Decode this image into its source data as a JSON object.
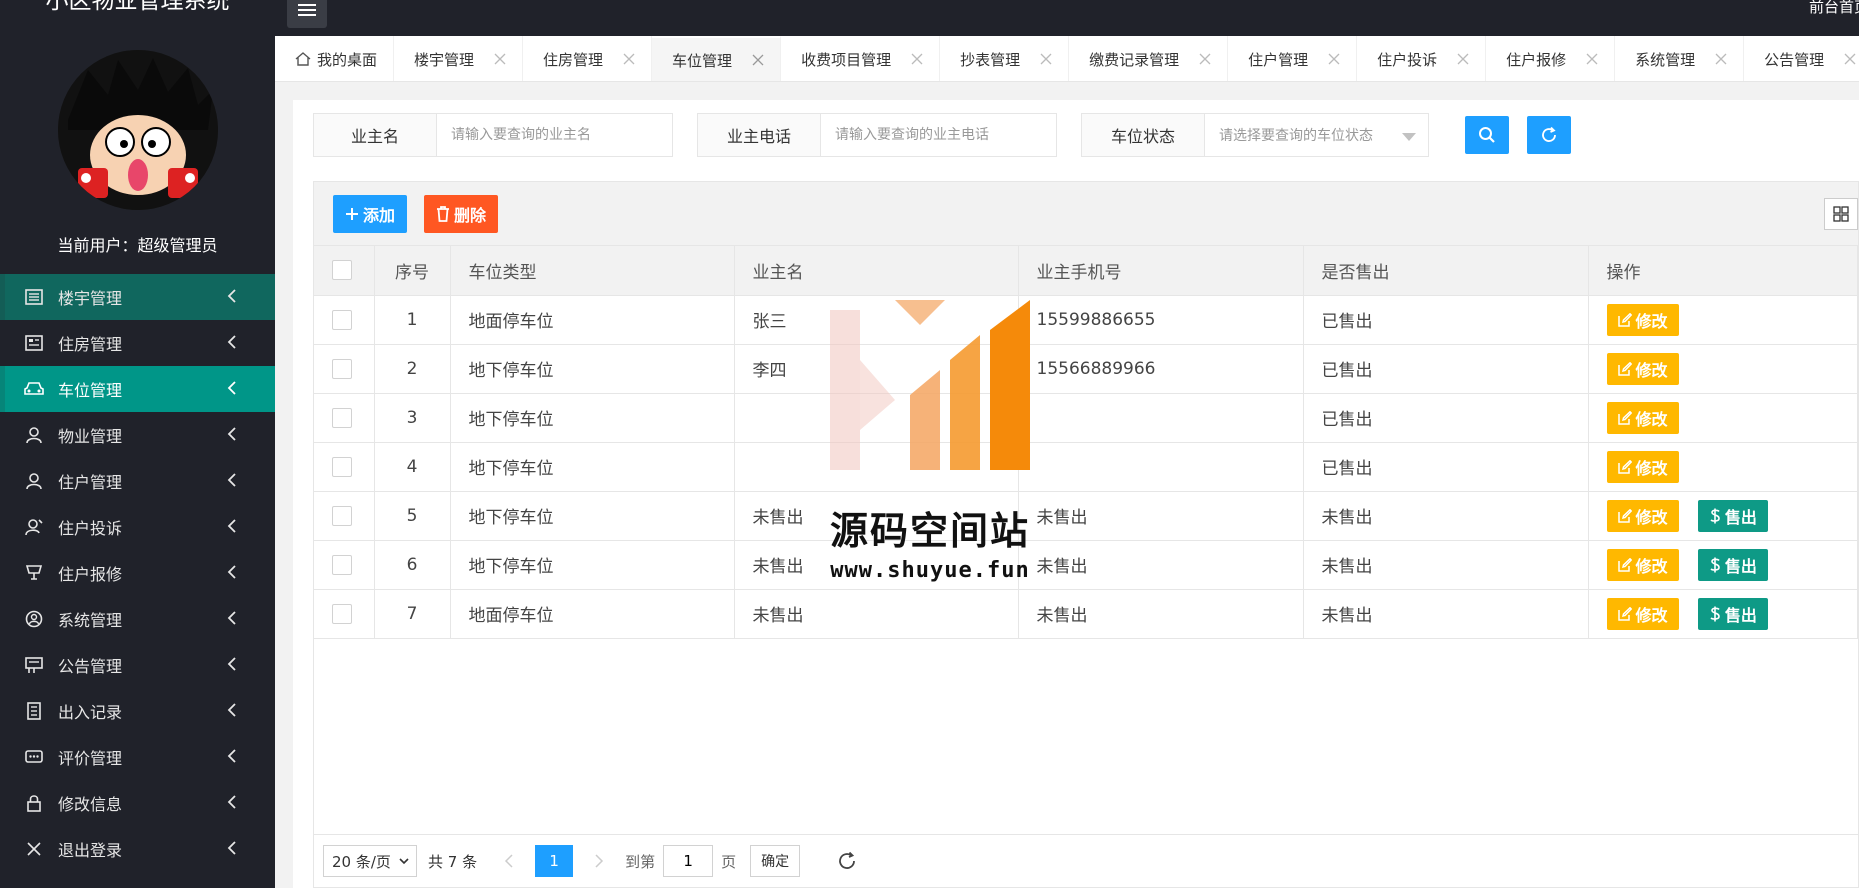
{
  "app": {
    "title": "小区物业管理系统",
    "current_user": "当前用户：超级管理员",
    "top_right": "前台首页"
  },
  "sidebar": {
    "items": [
      {
        "label": "楼宇管理",
        "icon": "building-icon"
      },
      {
        "label": "住房管理",
        "icon": "house-icon"
      },
      {
        "label": "车位管理",
        "icon": "car-icon"
      },
      {
        "label": "物业管理",
        "icon": "person-icon"
      },
      {
        "label": "住户管理",
        "icon": "user-icon"
      },
      {
        "label": "住户投诉",
        "icon": "complaint-icon"
      },
      {
        "label": "住户报修",
        "icon": "repair-icon"
      },
      {
        "label": "系统管理",
        "icon": "system-icon"
      },
      {
        "label": "公告管理",
        "icon": "notice-icon"
      },
      {
        "label": "出入记录",
        "icon": "record-icon"
      },
      {
        "label": "评价管理",
        "icon": "comment-icon"
      },
      {
        "label": "修改信息",
        "icon": "lock-icon"
      },
      {
        "label": "退出登录",
        "icon": "logout-icon"
      }
    ]
  },
  "tabs": [
    {
      "label": "我的桌面"
    },
    {
      "label": "楼宇管理"
    },
    {
      "label": "住房管理"
    },
    {
      "label": "车位管理"
    },
    {
      "label": "收费项目管理"
    },
    {
      "label": "抄表管理"
    },
    {
      "label": "缴费记录管理"
    },
    {
      "label": "住户管理"
    },
    {
      "label": "住户投诉"
    },
    {
      "label": "住户报修"
    },
    {
      "label": "系统管理"
    },
    {
      "label": "公告管理"
    }
  ],
  "search": {
    "owner_label": "业主名",
    "owner_placeholder": "请输入要查询的业主名",
    "phone_label": "业主电话",
    "phone_placeholder": "请输入要查询的业主电话",
    "status_label": "车位状态",
    "status_placeholder": "请选择要查询的车位状态"
  },
  "toolbar": {
    "add_label": "添加",
    "delete_label": "删除"
  },
  "table": {
    "headers": [
      "序号",
      "车位类型",
      "业主名",
      "业主手机号",
      "是否售出",
      "操作"
    ],
    "rows": [
      {
        "no": "1",
        "type": "地面停车位",
        "owner": "张三",
        "phone": "15599886655",
        "sold": "已售出"
      },
      {
        "no": "2",
        "type": "地下停车位",
        "owner": "李四",
        "phone": "15566889966",
        "sold": "已售出"
      },
      {
        "no": "3",
        "type": "地下停车位",
        "owner": "",
        "phone": "",
        "sold": "已售出"
      },
      {
        "no": "4",
        "type": "地下停车位",
        "owner": "",
        "phone": "",
        "sold": "已售出"
      },
      {
        "no": "5",
        "type": "地下停车位",
        "owner": "未售出",
        "phone": "未售出",
        "sold": "未售出"
      },
      {
        "no": "6",
        "type": "地下停车位",
        "owner": "未售出",
        "phone": "未售出",
        "sold": "未售出"
      },
      {
        "no": "7",
        "type": "地面停车位",
        "owner": "未售出",
        "phone": "未售出",
        "sold": "未售出"
      }
    ],
    "edit_label": "修改",
    "sell_label": "售出"
  },
  "pager": {
    "size": "20 条/页",
    "total": "共 7 条",
    "current": "1",
    "goto_label": "到第",
    "goto_value": "1",
    "page_label": "页",
    "confirm": "确定"
  },
  "watermark": {
    "text": "源码空间站",
    "url": "www.shuyue.fun"
  },
  "colors": {
    "sidebar_bg": "#20222a",
    "menu_active": "#009688",
    "primary": "#1e9fff",
    "danger": "#ff5722",
    "warn": "#ffb800"
  }
}
